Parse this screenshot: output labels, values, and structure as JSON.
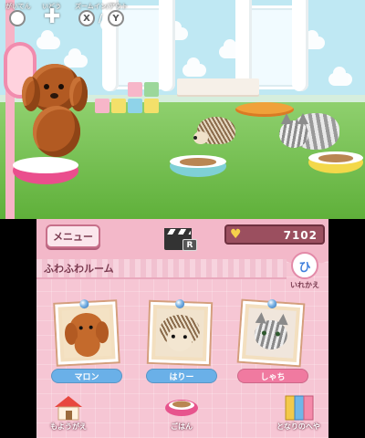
{
  "top_hud": {
    "label_gaiten": "がいてん",
    "label_idou": "いどう",
    "label_zoom": "ズームイン/アウト",
    "btn_x": "X",
    "btn_y": "Y",
    "sep": "/"
  },
  "bottom": {
    "menu_label": "メニュー",
    "clapper_badge": "R",
    "coins": "7102",
    "room_name": "ふわふわルーム",
    "swap_label": "いれかえ",
    "swap_glyph": "ひ",
    "pets": [
      {
        "name": "マロン",
        "plate_color": "#6ab0e8"
      },
      {
        "name": "はりー",
        "plate_color": "#6ab0e8"
      },
      {
        "name": "しゃち",
        "plate_color": "#f07aa0"
      }
    ],
    "buttons": [
      {
        "label": "もようがえ",
        "icon": "house-icon"
      },
      {
        "label": "ごはん",
        "icon": "food-bowl-icon"
      },
      {
        "label": "となりのへや",
        "icon": "door-icon"
      }
    ]
  },
  "colors": {
    "accent_pink": "#f3b8c9",
    "coin_box": "#9b4f5f",
    "grass": "#76c246"
  }
}
